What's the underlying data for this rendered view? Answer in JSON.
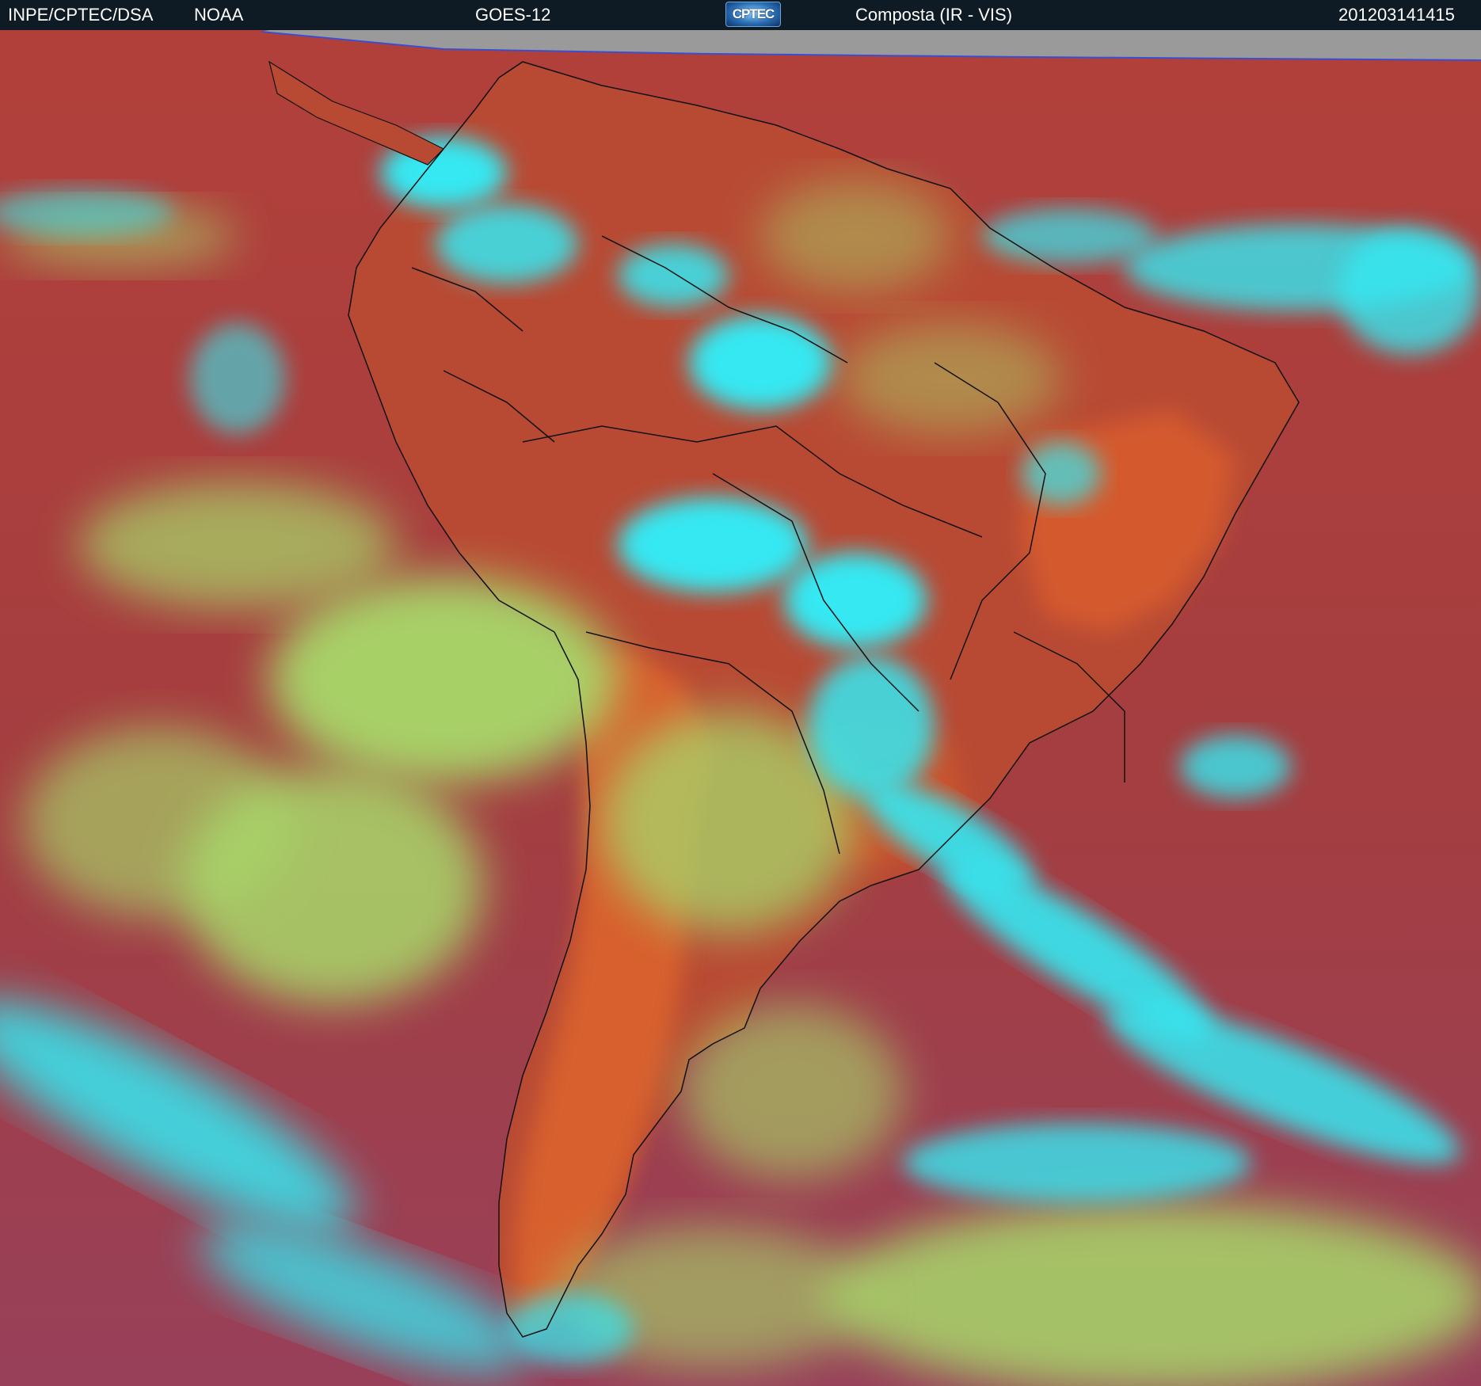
{
  "header": {
    "org": "INPE/CPTEC/DSA",
    "agency": "NOAA",
    "satellite": "GOES-12",
    "logo_text": "CPTEC",
    "product": "Composta (IR - VIS)",
    "timestamp": "201203141415"
  },
  "colors": {
    "header_bg": "#0e1a24",
    "clear_surface": "#a83e3a",
    "land_warm": "#d2582e",
    "low_cloud": "#a6d86a",
    "high_cloud": "#33e6f2",
    "no_data": "#9a9a9a",
    "borders": "#111111"
  }
}
